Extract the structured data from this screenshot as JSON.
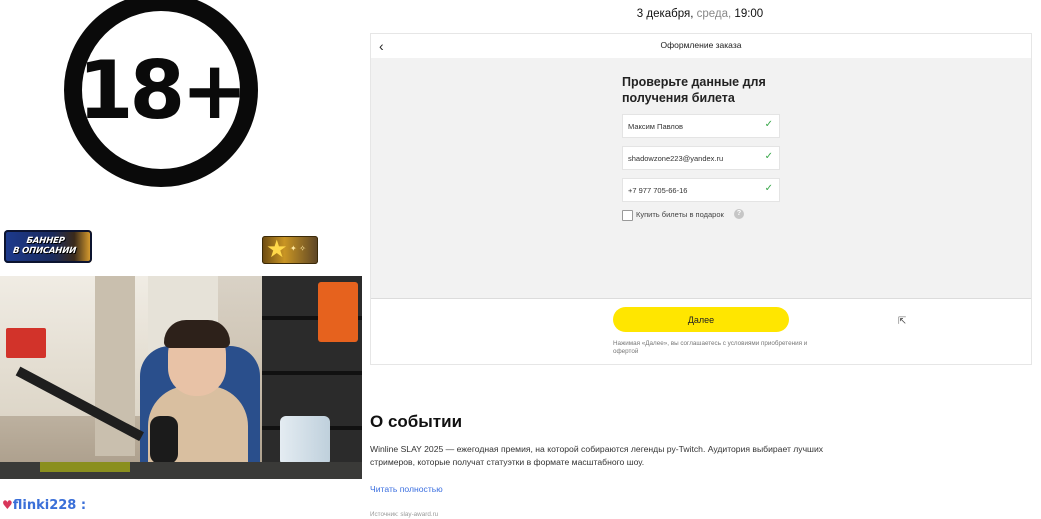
{
  "stream": {
    "age_rating": "18+",
    "banner_text": "БАННЕР\nВ ОПИСАНИИ",
    "chat": {
      "username": "flinki228 :",
      "message": "                                      "
    }
  },
  "page": {
    "datetime": {
      "date": "3 декабря,",
      "weekday": " среда,",
      "time": " 19:00"
    },
    "order": {
      "back_icon": "chevron-left-icon",
      "title": "Оформление заказа",
      "heading": "Проверьте данные для получения билета",
      "fields": {
        "name": "Максим Павлов",
        "email": "shadowzone223@yandex.ru",
        "phone": "+7 977 705-66-16"
      },
      "gift_label": "Купить билеты в подарок",
      "gift_checked": false,
      "help_icon": "?",
      "next_label": "Далее",
      "terms": "Нажимая «Далее», вы соглашаетесь с условиями приобретения и офертой"
    },
    "about": {
      "title": "О событии",
      "description": "Winline SLAY 2025 — ежегодная премия, на которой собираются легенды ру-Twitch. Аудитория выбирает лучших стримеров, которые получат статуэтки в формате масштабного шоу.",
      "read_more": "Читать полностью",
      "source": "Источник: slay-award.ru"
    }
  },
  "colors": {
    "accent_yellow": "#ffe600",
    "check_green": "#39a84a",
    "link_blue": "#3b6fe0",
    "chat_name": "#3a6fd8"
  }
}
